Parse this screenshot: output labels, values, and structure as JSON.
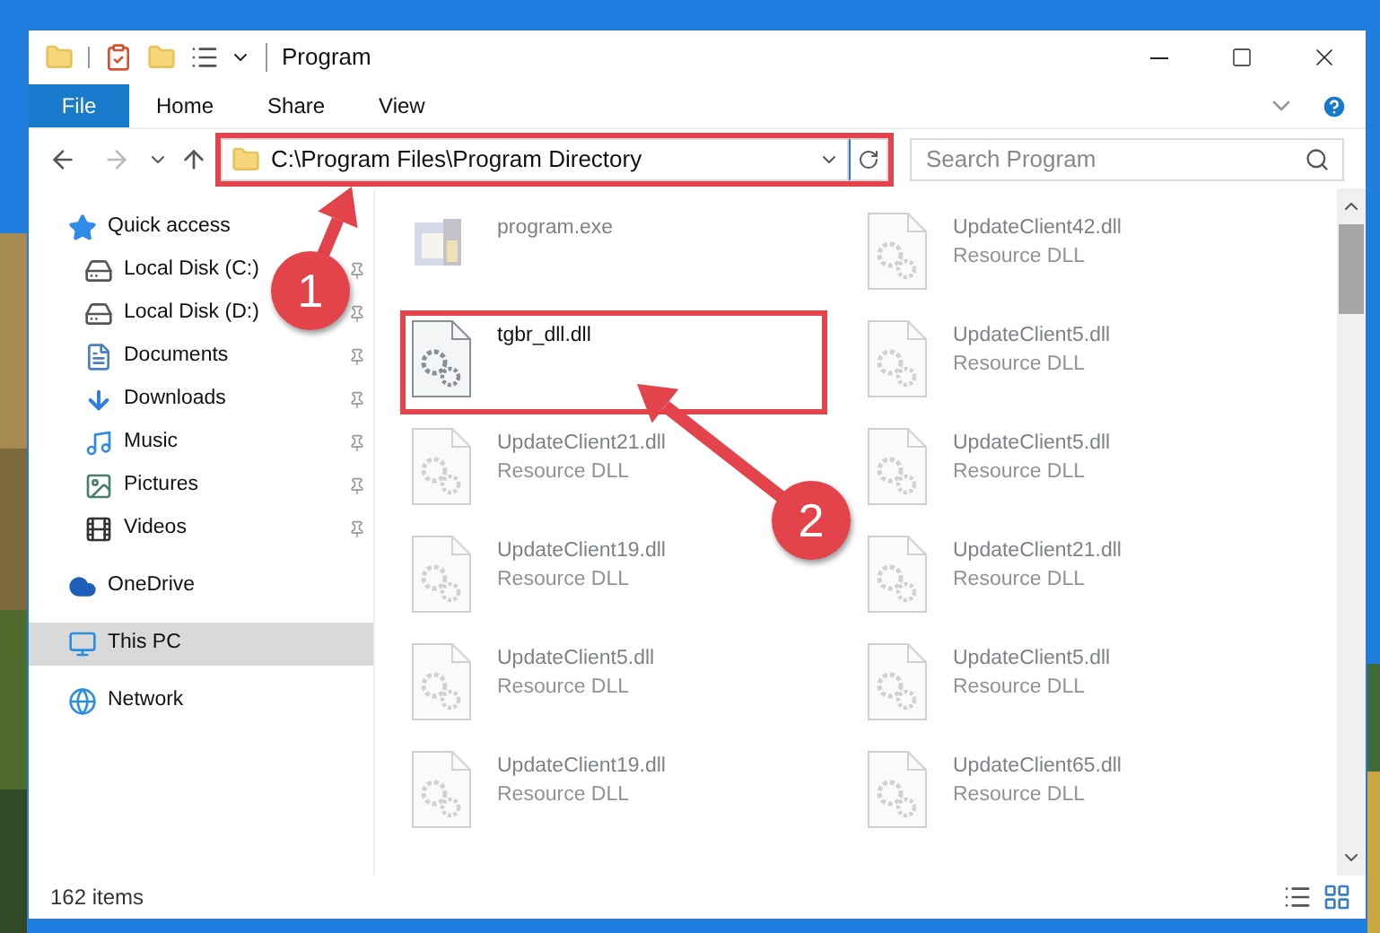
{
  "window": {
    "title": "Program"
  },
  "ribbon_tabs": [
    {
      "label": "File",
      "kind": "file",
      "selected": false
    },
    {
      "label": "Home",
      "kind": "tab",
      "selected": false
    },
    {
      "label": "Share",
      "kind": "tab",
      "selected": false
    },
    {
      "label": "View",
      "kind": "tab",
      "selected": false
    }
  ],
  "address": {
    "value": "C:\\Program Files\\Program Directory",
    "highlighted": true
  },
  "search": {
    "placeholder": "Search Program"
  },
  "sidebar": {
    "items": [
      {
        "label": "Quick access",
        "kind": "quick",
        "selected": false,
        "children": [
          {
            "label": "Local Disk (C:)",
            "kind": "drive-c",
            "pinned": true
          },
          {
            "label": "Local Disk (D:)",
            "kind": "drive",
            "pinned": true
          },
          {
            "label": "Documents",
            "kind": "documents",
            "pinned": true
          },
          {
            "label": "Downloads",
            "kind": "downloads",
            "pinned": true
          },
          {
            "label": "Music",
            "kind": "music",
            "pinned": true
          },
          {
            "label": "Pictures",
            "kind": "pictures",
            "pinned": true
          },
          {
            "label": "Videos",
            "kind": "videos",
            "pinned": true
          }
        ]
      },
      {
        "label": "OneDrive",
        "kind": "onedrive",
        "selected": false
      },
      {
        "label": "This PC",
        "kind": "pc",
        "selected": true
      },
      {
        "label": "Network",
        "kind": "network",
        "selected": false
      }
    ]
  },
  "files": {
    "columns": [
      [
        {
          "name": "program.exe",
          "kind": "exe",
          "dimmed": true,
          "highlighted": false
        },
        {
          "name": "tgbr_dll.dll",
          "kind": "dll",
          "dimmed": false,
          "highlighted": true
        },
        {
          "name": "UpdateClient21.dll",
          "type": "Resource DLL",
          "kind": "dll",
          "dimmed": true,
          "highlighted": false
        },
        {
          "name": "UpdateClient19.dll",
          "type": "Resource DLL",
          "kind": "dll",
          "dimmed": true,
          "highlighted": false
        },
        {
          "name": "UpdateClient5.dll",
          "type": "Resource DLL",
          "kind": "dll",
          "dimmed": true,
          "highlighted": false
        },
        {
          "name": "UpdateClient19.dll",
          "type": "Resource DLL",
          "kind": "dll",
          "dimmed": true,
          "highlighted": false
        }
      ],
      [
        {
          "name": "UpdateClient42.dll",
          "type": "Resource DLL",
          "kind": "dll",
          "dimmed": true,
          "highlighted": false
        },
        {
          "name": "UpdateClient5.dll",
          "type": "Resource DLL",
          "kind": "dll",
          "dimmed": true,
          "highlighted": false
        },
        {
          "name": "UpdateClient5.dll",
          "type": "Resource DLL",
          "kind": "dll",
          "dimmed": true,
          "highlighted": false
        },
        {
          "name": "UpdateClient21.dll",
          "type": "Resource DLL",
          "kind": "dll",
          "dimmed": true,
          "highlighted": false
        },
        {
          "name": "UpdateClient5.dll",
          "type": "Resource DLL",
          "kind": "dll",
          "dimmed": true,
          "highlighted": false
        },
        {
          "name": "UpdateClient65.dll",
          "type": "Resource DLL",
          "kind": "dll",
          "dimmed": true,
          "highlighted": false
        }
      ]
    ]
  },
  "status_bar": {
    "text": "162 items"
  },
  "annotations": [
    {
      "label": "1"
    },
    {
      "label": "2"
    }
  ]
}
